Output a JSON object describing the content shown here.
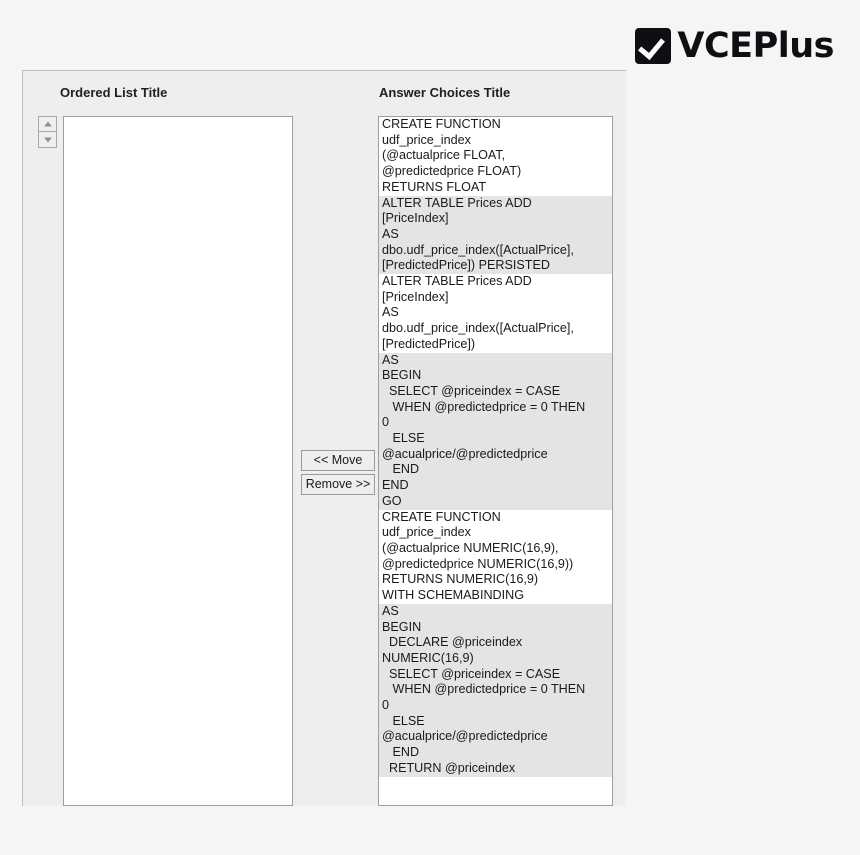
{
  "logo": {
    "icon": "checkbox-checked-icon",
    "text": "VCEPlus"
  },
  "panel": {
    "ordered_list": {
      "header": "Ordered List Title",
      "items": [],
      "spinner": {
        "up_icon": "triangle-up-icon",
        "down_icon": "triangle-down-icon"
      }
    },
    "buttons": {
      "move": "<< Move",
      "remove": "Remove >>"
    },
    "answer_choices": {
      "header": "Answer Choices Title",
      "items": [
        {
          "shaded": false,
          "text": "CREATE FUNCTION\nudf_price_index\n(@actualprice FLOAT,\n@predictedprice FLOAT)\nRETURNS FLOAT"
        },
        {
          "shaded": true,
          "text": "ALTER TABLE Prices ADD\n[PriceIndex]\nAS\ndbo.udf_price_index([ActualPrice],\n[PredictedPrice]) PERSISTED"
        },
        {
          "shaded": false,
          "text": "ALTER TABLE Prices ADD\n[PriceIndex]\nAS\ndbo.udf_price_index([ActualPrice],\n[PredictedPrice])"
        },
        {
          "shaded": true,
          "text": "AS\nBEGIN\n  SELECT @priceindex = CASE\n   WHEN @predictedprice = 0 THEN\n0\n   ELSE\n@acualprice/@predictedprice\n   END\nEND\nGO"
        },
        {
          "shaded": false,
          "text": "CREATE FUNCTION\nudf_price_index\n(@actualprice NUMERIC(16,9),\n@predictedprice NUMERIC(16,9))\nRETURNS NUMERIC(16,9)\nWITH SCHEMABINDING"
        },
        {
          "shaded": true,
          "text": "AS\nBEGIN\n  DECLARE @priceindex\nNUMERIC(16,9)\n  SELECT @priceindex = CASE\n   WHEN @predictedprice = 0 THEN\n0\n   ELSE\n@acualprice/@predictedprice\n   END\n  RETURN @priceindex"
        }
      ]
    }
  }
}
